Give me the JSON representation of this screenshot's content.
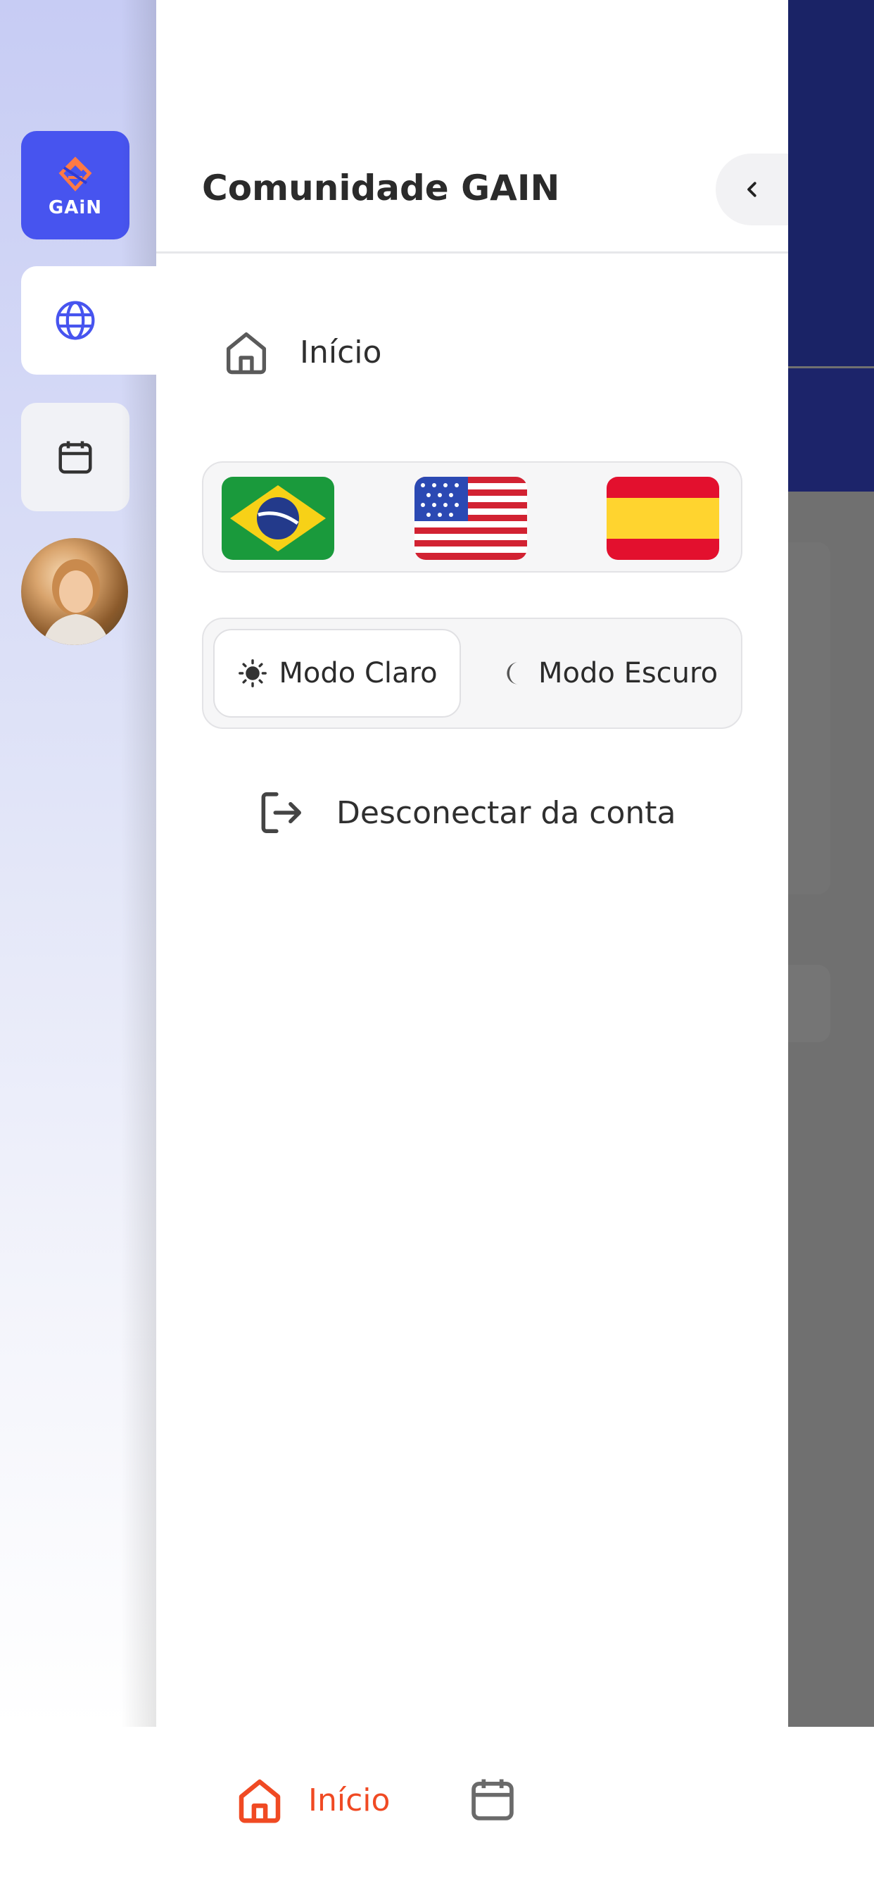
{
  "drawer": {
    "title": "Comunidade GAIN",
    "collapse_icon": "chevron-left-icon",
    "nav_items": [
      {
        "label": "Início",
        "icon": "home-icon"
      }
    ],
    "languages": [
      {
        "name": "Português",
        "icon": "brazil-flag-icon"
      },
      {
        "name": "English",
        "icon": "usa-flag-icon"
      },
      {
        "name": "Español",
        "icon": "spain-flag-icon"
      }
    ],
    "theme": {
      "light_label": "Modo Claro",
      "dark_label": "Modo Escuro",
      "selected": "light"
    },
    "logout_label": "Desconectar da conta"
  },
  "rail": {
    "logo_text": "GAiN",
    "items": [
      {
        "icon": "globe-icon",
        "active": true
      },
      {
        "icon": "calendar-icon",
        "active": false
      },
      {
        "icon": "avatar",
        "active": false
      }
    ]
  },
  "tabbar": {
    "home_label": "Início",
    "active": "home"
  },
  "colors": {
    "accent": "#4754ef",
    "tab_active": "#f04a23",
    "backdrop_header": "#1a2366"
  }
}
